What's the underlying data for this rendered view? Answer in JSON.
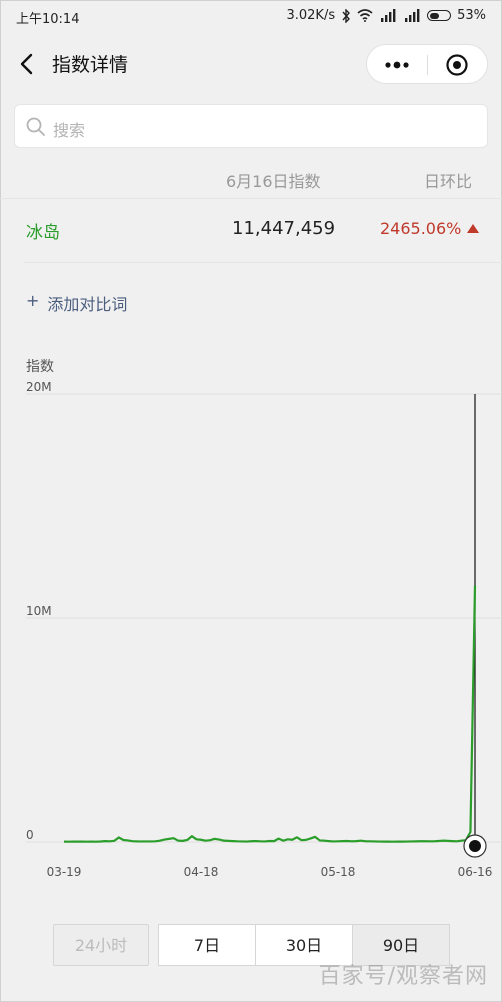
{
  "status_bar": {
    "time": "上午10:14",
    "speed": "3.02K/s",
    "battery": "53%",
    "battery_level": 0.53,
    "icons": [
      "bluetooth-icon",
      "wifi-icon",
      "signal-hd-icon",
      "signal-hd-icon",
      "battery-icon"
    ]
  },
  "header": {
    "title": "指数详情",
    "back_icon": "chevron-left-icon",
    "more_icon": "more-dots-icon",
    "target_icon": "target-icon"
  },
  "search": {
    "placeholder": "搜索",
    "icon": "search-icon"
  },
  "table": {
    "col_date": "6月16日指数",
    "col_ratio": "日环比",
    "row": {
      "name": "冰岛",
      "value": "11,447,459",
      "ratio": "2465.06%",
      "trend": "up",
      "name_color": "#2a9d2a",
      "ratio_color": "#c0392b"
    }
  },
  "add_compare": {
    "plus": "+",
    "label": "添加对比词"
  },
  "chart_data": {
    "type": "line",
    "ylabel": "指数",
    "y_ticks": [
      "20M",
      "10M",
      "0"
    ],
    "ylim": [
      0,
      20000000
    ],
    "x_tick_labels": [
      "03-19",
      "04-18",
      "05-18",
      "06-16"
    ],
    "line_color": "#2a9d2a",
    "series": [
      {
        "values": [
          15000,
          14000,
          15000,
          17000,
          16000,
          14000,
          15000,
          13000,
          22000,
          38000,
          30000,
          52000,
          200000,
          90000,
          70000,
          36000,
          28000,
          25000,
          26000,
          24000,
          30000,
          60000,
          110000,
          140000,
          170000,
          60000,
          50000,
          90000,
          260000,
          120000,
          100000,
          60000,
          80000,
          140000,
          110000,
          60000,
          50000,
          40000,
          30000,
          25000,
          20000,
          35000,
          40000,
          30000,
          25000,
          45000,
          38000,
          150000,
          60000,
          120000,
          100000,
          210000,
          80000,
          95000,
          160000,
          230000,
          70000,
          60000,
          40000,
          25000,
          30000,
          38000,
          45000,
          30000,
          40000,
          60000,
          35000,
          30000,
          25000,
          20000,
          18000,
          15000,
          14000,
          16000,
          18000,
          20000,
          25000,
          28000,
          32000,
          35000,
          30000,
          30000,
          45000,
          60000,
          50000,
          40000,
          30000,
          60000,
          80000,
          446588,
          11447459
        ]
      }
    ]
  },
  "range": {
    "buttons": [
      "24小时",
      "7日",
      "30日",
      "90日"
    ],
    "active": "90日",
    "disabled": "24小时"
  },
  "watermark": "百家号/观察者网"
}
